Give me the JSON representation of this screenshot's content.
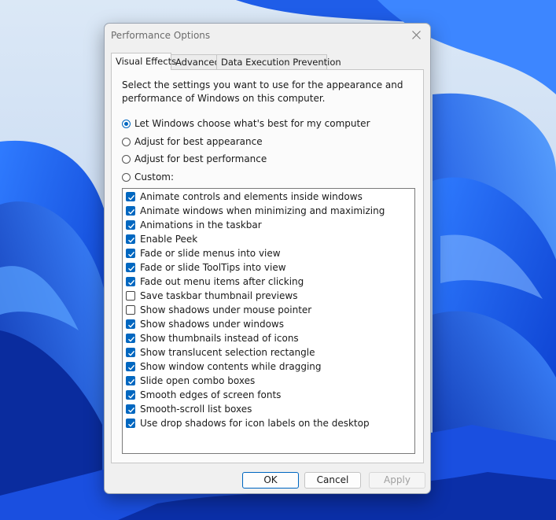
{
  "window": {
    "title": "Performance Options"
  },
  "tabs": [
    {
      "label": "Visual Effects",
      "active": true
    },
    {
      "label": "Advanced",
      "active": false
    },
    {
      "label": "Data Execution Prevention",
      "active": false
    }
  ],
  "visual_effects": {
    "description": "Select the settings you want to use for the appearance and performance of Windows on this computer.",
    "radios": [
      {
        "label": "Let Windows choose what's best for my computer",
        "checked": true
      },
      {
        "label": "Adjust for best appearance",
        "checked": false
      },
      {
        "label": "Adjust for best performance",
        "checked": false
      },
      {
        "label": "Custom:",
        "checked": false
      }
    ],
    "options": [
      {
        "label": "Animate controls and elements inside windows",
        "checked": true
      },
      {
        "label": "Animate windows when minimizing and maximizing",
        "checked": true
      },
      {
        "label": "Animations in the taskbar",
        "checked": true
      },
      {
        "label": "Enable Peek",
        "checked": true
      },
      {
        "label": "Fade or slide menus into view",
        "checked": true
      },
      {
        "label": "Fade or slide ToolTips into view",
        "checked": true
      },
      {
        "label": "Fade out menu items after clicking",
        "checked": true
      },
      {
        "label": "Save taskbar thumbnail previews",
        "checked": false
      },
      {
        "label": "Show shadows under mouse pointer",
        "checked": false
      },
      {
        "label": "Show shadows under windows",
        "checked": true
      },
      {
        "label": "Show thumbnails instead of icons",
        "checked": true
      },
      {
        "label": "Show translucent selection rectangle",
        "checked": true
      },
      {
        "label": "Show window contents while dragging",
        "checked": true
      },
      {
        "label": "Slide open combo boxes",
        "checked": true
      },
      {
        "label": "Smooth edges of screen fonts",
        "checked": true
      },
      {
        "label": "Smooth-scroll list boxes",
        "checked": true
      },
      {
        "label": "Use drop shadows for icon labels on the desktop",
        "checked": true
      }
    ]
  },
  "buttons": {
    "ok": "OK",
    "cancel": "Cancel",
    "apply": "Apply"
  },
  "colors": {
    "accent": "#0067c0",
    "dialog_bg": "#f0f0f0",
    "panel_bg": "#fbfbfb"
  }
}
